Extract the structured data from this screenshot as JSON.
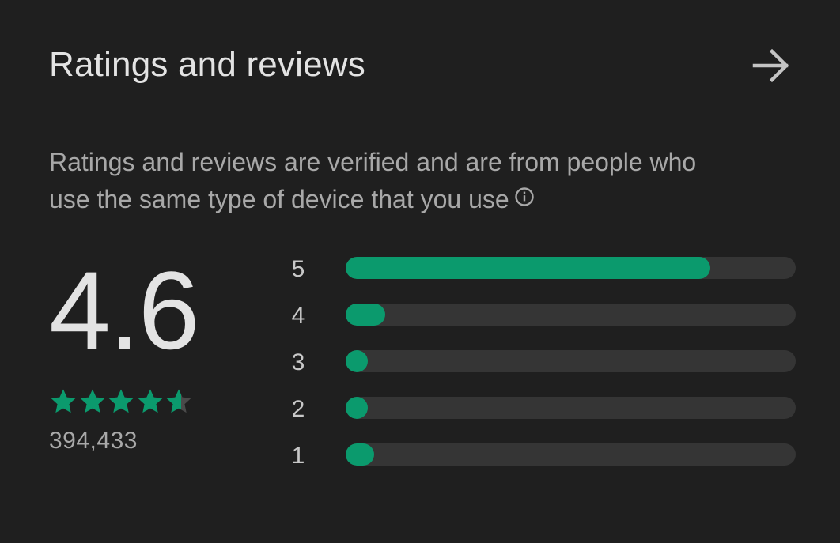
{
  "header": {
    "title": "Ratings and reviews",
    "arrow_icon": "arrow-right-icon"
  },
  "subtitle": {
    "line1": "Ratings and reviews are verified and are from people who",
    "line2": "use the same type of device that you use",
    "info_icon": "info-icon"
  },
  "summary": {
    "score": "4.6",
    "stars_value": 4.6,
    "stars_max": 5,
    "review_count": "394,433"
  },
  "distribution": [
    {
      "label": "5",
      "fraction": 0.81
    },
    {
      "label": "4",
      "fraction": 0.087
    },
    {
      "label": "3",
      "fraction": 0.05
    },
    {
      "label": "2",
      "fraction": 0.05
    },
    {
      "label": "1",
      "fraction": 0.064
    }
  ],
  "colors": {
    "background": "#1f1f1f",
    "accent": "#0b9a6d",
    "track": "#353535",
    "star_empty": "#4a4a4a"
  }
}
